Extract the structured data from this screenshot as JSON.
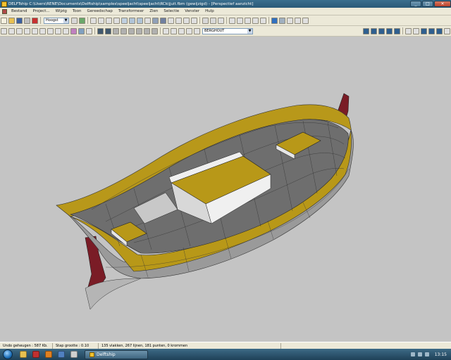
{
  "window": {
    "title": "DELFTship C:\\Users\\RENE\\Documents\\Delftship\\samples\\speeljacht\\speeljacht\\RCkijjuit.fbm (gewijzigd) - [Perspectief aanzicht]",
    "controls": [
      "_",
      "□",
      "✕"
    ]
  },
  "menu": [
    "Bestand",
    "Project...",
    "Wijzig",
    "Toon",
    "Gereedschap",
    "Transformeer",
    "Zien",
    "Selectie",
    "Venster",
    "Hulp"
  ],
  "toolbar1": {
    "combo": "Hoogst"
  },
  "toolbar2": {
    "combo": "BERGHOUT"
  },
  "status": {
    "undo": "Undo geheugen : 587 Kb.",
    "step": "Stap grootte : 0.10",
    "counts": "135 vlakken, 267 lijnen, 181 punten, 0 krommen"
  },
  "taskbar": {
    "app": "Delftship",
    "time": "13:15"
  },
  "colors": {
    "viewport": "#c4c4c4",
    "deck": "#6e6e6e",
    "sheer": "#b8981a",
    "hull_side": "#9a9a9a",
    "keel": "#7a1c26"
  }
}
